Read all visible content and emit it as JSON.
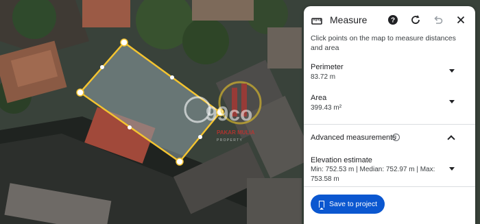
{
  "panel": {
    "title": "Measure",
    "description": "Click points on the map to measure distances and area",
    "perimeter": {
      "label": "Perimeter",
      "value": "83.72 m"
    },
    "area": {
      "label": "Area",
      "value": "399.43 m²"
    },
    "advanced": {
      "label": "Advanced measurements",
      "info_icon": "info-icon"
    },
    "elevation": {
      "label": "Elevation estimate",
      "value": "Min: 752.53 m | Median: 752.97 m | Max: 753.58 m"
    },
    "save_button": "Save to project"
  },
  "watermark": {
    "brand": "99co",
    "company": "PAKAR MULIA",
    "company_sub": "P R O P E R T Y"
  },
  "colors": {
    "measure_line": "#f4c430",
    "primary_button": "#0b57d0"
  }
}
